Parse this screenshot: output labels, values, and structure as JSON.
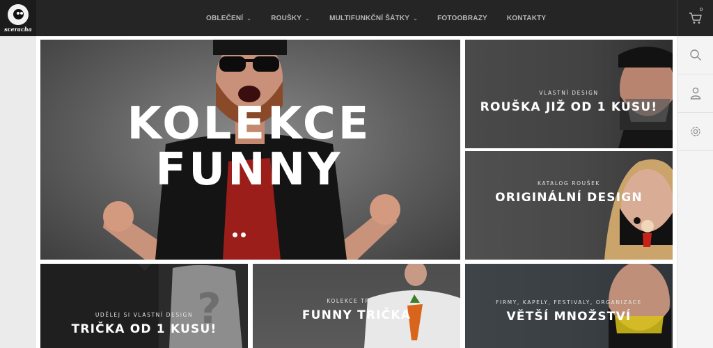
{
  "brand": {
    "logo_text": "sceracha"
  },
  "nav": {
    "items": [
      {
        "label": "OBLEČENÍ",
        "has_dropdown": true
      },
      {
        "label": "ROUŠKY",
        "has_dropdown": true
      },
      {
        "label": "MULTIFUNKČNÍ ŠÁTKY",
        "has_dropdown": true
      },
      {
        "label": "FOTOOBRAZY",
        "has_dropdown": false
      },
      {
        "label": "KONTAKTY",
        "has_dropdown": false
      }
    ],
    "dropdown_glyph": "⌄"
  },
  "cart": {
    "count": "0",
    "icon": "cart-icon"
  },
  "sidebar": {
    "icons": [
      "search-icon",
      "user-icon",
      "gear-icon"
    ]
  },
  "hero": {
    "title_line1": "KOLEKCE",
    "title_line2": "FUNNY",
    "slide_dots": 2
  },
  "tiles": [
    {
      "subtitle": "VLASTNÍ DESIGN",
      "title": "ROUŠKA JIŽ OD 1 KUSU!"
    },
    {
      "subtitle": "KATALOG ROUŠEK",
      "title": "ORIGINÁLNÍ DESIGN"
    },
    {
      "subtitle": "UDĚLEJ SI VLASTNÍ DESIGN",
      "title": "TRIČKA OD 1 KUSU!"
    },
    {
      "subtitle": "KOLEKCE TRIČEK",
      "title": "FUNNY TRIČKA"
    },
    {
      "subtitle": "FIRMY, KAPELY, FESTIVALY, ORGANIZACE",
      "title": "VĚTŠÍ MNOŽSTVÍ"
    }
  ],
  "colors": {
    "topbar": "#252525",
    "nav_text": "#b5b5b5",
    "sidebar_bg": "#f4f4f4",
    "caption_text": "#ffffff"
  }
}
